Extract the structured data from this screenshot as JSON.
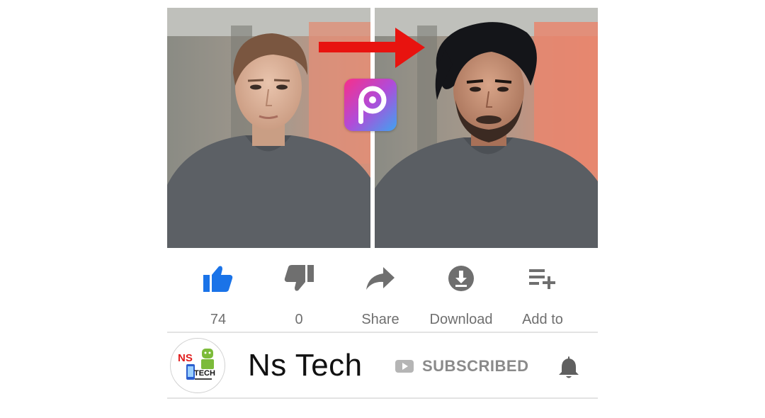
{
  "actions": {
    "like": {
      "label": "74",
      "icon": "thumbs-up-icon",
      "active_color": "#1a73e8"
    },
    "dislike": {
      "label": "0",
      "icon": "thumbs-down-icon"
    },
    "share": {
      "label": "Share",
      "icon": "share-arrow-icon"
    },
    "download": {
      "label": "Download",
      "icon": "download-icon"
    },
    "add_to": {
      "label": "Add to",
      "icon": "playlist-add-icon"
    }
  },
  "channel": {
    "name": "Ns Tech",
    "subscribe_status": "SUBSCRIBED",
    "avatar_text_top": "NS",
    "avatar_text_bottom": "TECH",
    "notification_icon": "bell-icon"
  },
  "thumbnail": {
    "comparison_arrow_color": "#e8130f",
    "app_logo": "picsart-logo-icon"
  }
}
